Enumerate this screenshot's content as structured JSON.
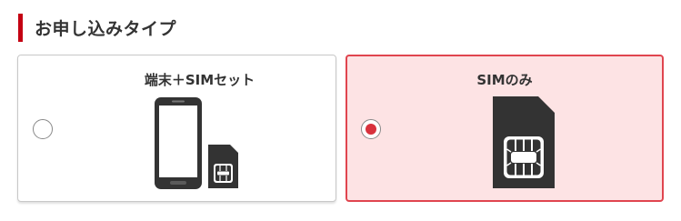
{
  "section": {
    "title": "お申し込みタイプ"
  },
  "options": [
    {
      "label": "端末＋SIMセット",
      "icon": "phone-and-sim-icon",
      "selected": false
    },
    {
      "label": "SIMのみ",
      "icon": "sim-card-icon",
      "selected": true
    }
  ],
  "colors": {
    "accent": "#c40012",
    "selected_border": "#e0454f",
    "selected_background": "#fde3e4",
    "radio_checked": "#d8323d"
  }
}
